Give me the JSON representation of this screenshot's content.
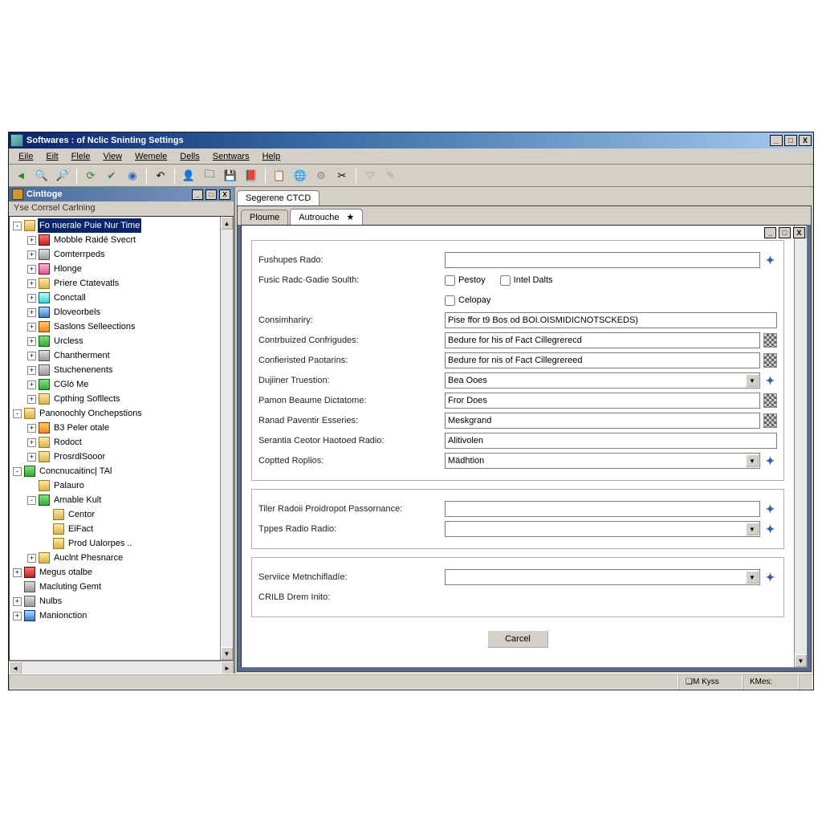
{
  "window": {
    "title": "Softwares : of Nclic Sninting Settings"
  },
  "menu": [
    "Eile",
    "Eilt",
    "Flele",
    "View",
    "Wemele",
    "Dells",
    "Sentwars",
    "Help"
  ],
  "left": {
    "panel_title": "Cinttoge",
    "panel_sub": "Yse Corrsel Carlning",
    "nodes": [
      {
        "d": 0,
        "exp": "-",
        "ic": "ic-folder",
        "label": "Fo nuerale Puie Nur Time",
        "sel": true
      },
      {
        "d": 1,
        "exp": "+",
        "ic": "ic-red",
        "label": "Mobble Raidé Svecrt"
      },
      {
        "d": 1,
        "exp": "+",
        "ic": "ic-gry",
        "label": "Comterrpeds"
      },
      {
        "d": 1,
        "exp": "+",
        "ic": "ic-pnk",
        "label": "Hlonge"
      },
      {
        "d": 1,
        "exp": "+",
        "ic": "ic-folder",
        "label": "Priere Ctatevatls"
      },
      {
        "d": 1,
        "exp": "+",
        "ic": "ic-cyn",
        "label": "Conctall"
      },
      {
        "d": 1,
        "exp": "+",
        "ic": "ic-blu",
        "label": "Dloveorbels"
      },
      {
        "d": 1,
        "exp": "+",
        "ic": "ic-org",
        "label": "Saslons Selleections"
      },
      {
        "d": 1,
        "exp": "+",
        "ic": "ic-grn",
        "label": "Urcless"
      },
      {
        "d": 1,
        "exp": "+",
        "ic": "ic-gry",
        "label": "Chantherment"
      },
      {
        "d": 1,
        "exp": "+",
        "ic": "ic-gry",
        "label": "Stuchenenents"
      },
      {
        "d": 1,
        "exp": "+",
        "ic": "ic-grn",
        "label": "CGló Me"
      },
      {
        "d": 1,
        "exp": "+",
        "ic": "ic-folder",
        "label": "Cpthing Sofllects"
      },
      {
        "d": 0,
        "exp": "-",
        "ic": "ic-folder",
        "label": "Panonochly Onchepstions"
      },
      {
        "d": 1,
        "exp": "+",
        "ic": "ic-org",
        "label": "B3 Peler otale"
      },
      {
        "d": 1,
        "exp": "+",
        "ic": "ic-folder",
        "label": "Rodoct"
      },
      {
        "d": 1,
        "exp": "+",
        "ic": "ic-folder",
        "label": "ProsrdlSooor"
      },
      {
        "d": 0,
        "exp": "-",
        "ic": "ic-grn",
        "label": "Concnucaitinc| TAl"
      },
      {
        "d": 1,
        "exp": "",
        "ic": "ic-folder",
        "label": "Palauro"
      },
      {
        "d": 1,
        "exp": "-",
        "ic": "ic-grn",
        "label": "Amable Kult"
      },
      {
        "d": 2,
        "exp": "",
        "ic": "ic-folder",
        "label": "Centor"
      },
      {
        "d": 2,
        "exp": "",
        "ic": "ic-folder",
        "label": "EiFact"
      },
      {
        "d": 2,
        "exp": "",
        "ic": "ic-folder",
        "label": "Prod Ualorpes .."
      },
      {
        "d": 1,
        "exp": "+",
        "ic": "ic-folder",
        "label": "Auclnt Phesnarce"
      },
      {
        "d": 0,
        "exp": "+",
        "ic": "ic-red",
        "label": "Megus otalbe"
      },
      {
        "d": 0,
        "exp": "",
        "ic": "ic-gry",
        "label": "Macluting Gemt"
      },
      {
        "d": 0,
        "exp": "+",
        "ic": "ic-gry",
        "label": "Nulbs"
      },
      {
        "d": 0,
        "exp": "+",
        "ic": "ic-blu",
        "label": "Manionction"
      }
    ]
  },
  "right": {
    "top_tab": "Segerene CTCD",
    "sub_tab1": "Ploume",
    "sub_tab2": "Autrouche",
    "sub_tab_star": "★",
    "form": {
      "f1_label": "Fushupes Rado:",
      "f1_value": "",
      "f2_label": "Fusic Radc·Gadie Soulth:",
      "chk1": "Pestoy",
      "chk2": "Intel Dalts",
      "chk3": "Celopay",
      "f3_label": "Consimhariry:",
      "f3_value": "Pise ffor t9 Bos od BOI.OISMIDICNOTSCKEDS)",
      "f4_label": "Contrbuized Confrigudes:",
      "f4_value": "Bedure for his of Fact Cillegrerecd",
      "f5_label": "Confieristed Paotarins:",
      "f5_value": "Bedure for nis of Fact Cillegrereed",
      "f6_label": "Dujiiner Truestion:",
      "f6_value": "Bea Ooes",
      "f7_label": "Pamon Beaume Dictatome:",
      "f7_value": "Fror Does",
      "f8_label": "Ranad Paventir Esseries:",
      "f8_value": "Meskgrand",
      "f9_label": "Serantia Ceotor Haotoed Radio:",
      "f9_value": "Alitivolen",
      "f10_label": "Coptted Roplios:",
      "f10_value": "Mädhtion",
      "f11_label": "Tiler Radoii Proidropot Passornance:",
      "f11_value": "",
      "f12_label": "Tppes Radio Radio:",
      "f12_value": "",
      "f13_label": "Serviice Metnchifladíe:",
      "f13_value": "",
      "f14_label": "CRILB Drem Inito:"
    },
    "cancel": "Carcel"
  },
  "status": {
    "s1": "M Kyss",
    "s2": "KMes:"
  }
}
